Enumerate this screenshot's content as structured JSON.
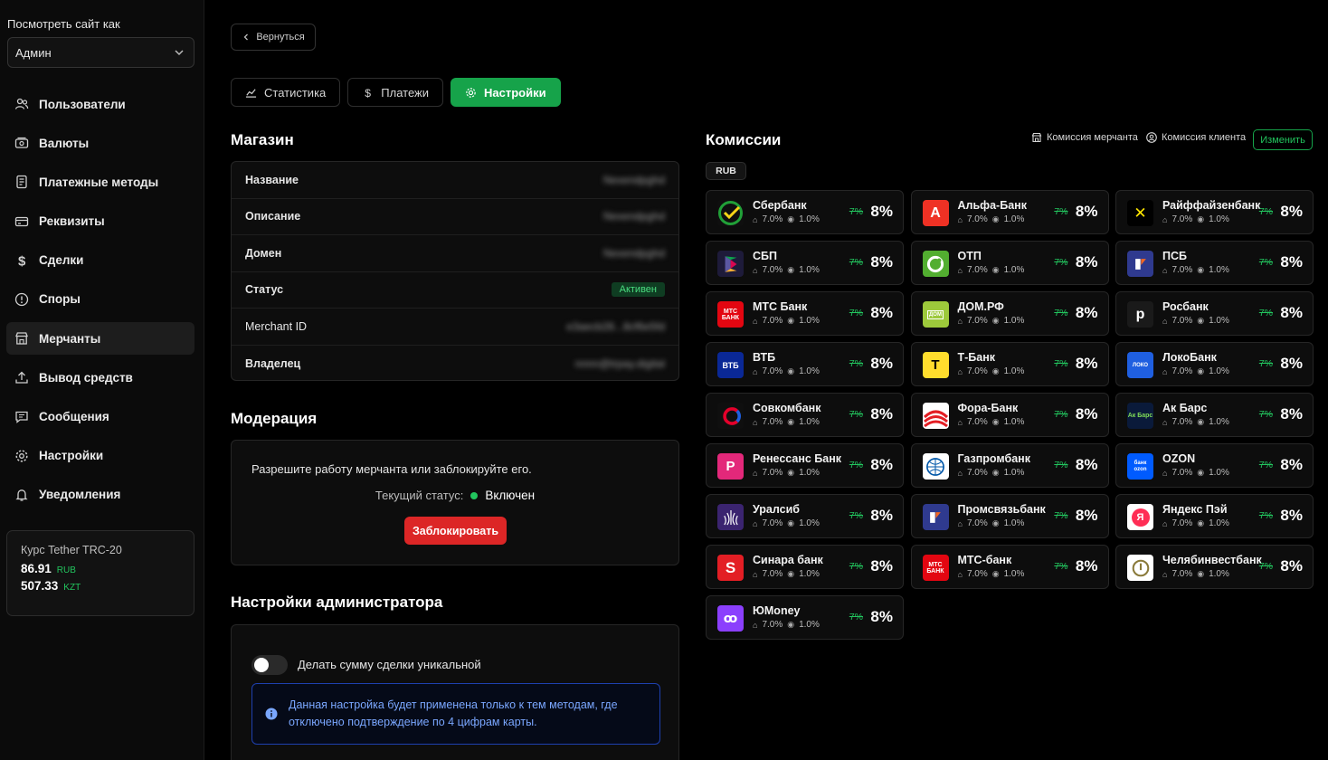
{
  "sidebar": {
    "view_as_label": "Посмотреть сайт как",
    "view_as_value": "Админ",
    "items": [
      {
        "label": "Пользователи",
        "icon": "users-icon"
      },
      {
        "label": "Валюты",
        "icon": "currency-icon"
      },
      {
        "label": "Платежные методы",
        "icon": "payment-methods-icon"
      },
      {
        "label": "Реквизиты",
        "icon": "card-icon"
      },
      {
        "label": "Сделки",
        "icon": "dollar-icon"
      },
      {
        "label": "Споры",
        "icon": "alert-icon"
      },
      {
        "label": "Мерчанты",
        "icon": "store-icon"
      },
      {
        "label": "Вывод средств",
        "icon": "upload-icon"
      },
      {
        "label": "Сообщения",
        "icon": "message-icon"
      },
      {
        "label": "Настройки",
        "icon": "gear-icon"
      },
      {
        "label": "Уведомления",
        "icon": "bell-icon"
      }
    ],
    "active_item": "Мерчанты",
    "rate": {
      "title": "Курс Tether TRC-20",
      "rows": [
        {
          "value": "86.91",
          "currency": "RUB"
        },
        {
          "value": "507.33",
          "currency": "KZT"
        }
      ]
    }
  },
  "main": {
    "back_label": "Вернуться",
    "tabs": [
      {
        "label": "Статистика",
        "icon": "chart-icon"
      },
      {
        "label": "Платежи",
        "icon": "dollar-icon"
      },
      {
        "label": "Настройки",
        "icon": "gear-icon"
      }
    ],
    "active_tab": "Настройки",
    "shop": {
      "title": "Магазин",
      "rows": [
        {
          "label": "Название",
          "value": "Nexendpghd"
        },
        {
          "label": "Описание",
          "value": "Nexendpghd"
        },
        {
          "label": "Домен",
          "value": "Nexendpghd"
        },
        {
          "label": "Статус",
          "value": "Активен"
        },
        {
          "label": "Merchant ID",
          "value": "e3aecb28...8cf6e5fd"
        },
        {
          "label": "Владелец",
          "value": "nnnn@trpay.digital"
        }
      ]
    },
    "moderation": {
      "title": "Модерация",
      "text": "Разрешите работу мерчанта или заблокируйте его.",
      "status_label": "Текущий статус:",
      "status_value": "Включен",
      "block_button": "Заблокировать"
    },
    "admin": {
      "title": "Настройки администратора",
      "toggle_label": "Делать сумму сделки уникальной",
      "toggle_on": false,
      "info_line1": "Данная настройка будет применена только к тем методам, где",
      "info_line2": "отключено подтверждение по 4 цифрам карты."
    }
  },
  "commissions": {
    "title": "Комиссии",
    "legend_merchant": "Комиссия мерчанта",
    "legend_client": "Комиссия клиента",
    "edit_button": "Изменить",
    "currency_badge": "RUB",
    "banks": [
      {
        "name": "Сбербанк",
        "merchant": "7.0%",
        "client": "1.0%",
        "old": "7%",
        "new": "8%",
        "color": "#0f0f0f",
        "logo": "sber-logo"
      },
      {
        "name": "Альфа-Банк",
        "merchant": "7.0%",
        "client": "1.0%",
        "old": "7%",
        "new": "8%",
        "color": "#ef3124",
        "logo": "alfa-logo"
      },
      {
        "name": "Райффайзенбанк",
        "merchant": "7.0%",
        "client": "1.0%",
        "old": "7%",
        "new": "8%",
        "color": "#000000",
        "logo": "raiffeisen-logo"
      },
      {
        "name": "СБП",
        "merchant": "7.0%",
        "client": "1.0%",
        "old": "7%",
        "new": "8%",
        "color": "#1e1b3a",
        "logo": "sbp-logo"
      },
      {
        "name": "ОТП",
        "merchant": "7.0%",
        "client": "1.0%",
        "old": "7%",
        "new": "8%",
        "color": "#52ae30",
        "logo": "otp-logo"
      },
      {
        "name": "ПСБ",
        "merchant": "7.0%",
        "client": "1.0%",
        "old": "7%",
        "new": "8%",
        "color": "#2f3a8f",
        "logo": "psb-logo"
      },
      {
        "name": "МТС Банк",
        "merchant": "7.0%",
        "client": "1.0%",
        "old": "7%",
        "new": "8%",
        "color": "#e30611",
        "logo": "mts-logo"
      },
      {
        "name": "ДОМ.РФ",
        "merchant": "7.0%",
        "client": "1.0%",
        "old": "7%",
        "new": "8%",
        "color": "#9dc93b",
        "logo": "domrf-logo"
      },
      {
        "name": "Росбанк",
        "merchant": "7.0%",
        "client": "1.0%",
        "old": "7%",
        "new": "8%",
        "color": "#1a1a1a",
        "logo": "rosbank-logo"
      },
      {
        "name": "ВТБ",
        "merchant": "7.0%",
        "client": "1.0%",
        "old": "7%",
        "new": "8%",
        "color": "#0a2896",
        "logo": "vtb-logo"
      },
      {
        "name": "Т-Банк",
        "merchant": "7.0%",
        "client": "1.0%",
        "old": "7%",
        "new": "8%",
        "color": "#ffdd2d",
        "logo": "tbank-logo"
      },
      {
        "name": "ЛокоБанк",
        "merchant": "7.0%",
        "client": "1.0%",
        "old": "7%",
        "new": "8%",
        "color": "#1f5fe0",
        "logo": "lokobank-logo"
      },
      {
        "name": "Совкомбанк",
        "merchant": "7.0%",
        "client": "1.0%",
        "old": "7%",
        "new": "8%",
        "color": "#0f0f0f",
        "logo": "sovcombank-logo"
      },
      {
        "name": "Фора-Банк",
        "merchant": "7.0%",
        "client": "1.0%",
        "old": "7%",
        "new": "8%",
        "color": "#ffffff",
        "logo": "fora-logo"
      },
      {
        "name": "Ак Барс",
        "merchant": "7.0%",
        "client": "1.0%",
        "old": "7%",
        "new": "8%",
        "color": "#0a1a3a",
        "logo": "akbars-logo"
      },
      {
        "name": "Ренессанс Банк",
        "merchant": "7.0%",
        "client": "1.0%",
        "old": "7%",
        "new": "8%",
        "color": "#e3287a",
        "logo": "renaissance-logo"
      },
      {
        "name": "Газпромбанк",
        "merchant": "7.0%",
        "client": "1.0%",
        "old": "7%",
        "new": "8%",
        "color": "#ffffff",
        "logo": "gazprombank-logo"
      },
      {
        "name": "OZON",
        "merchant": "7.0%",
        "client": "1.0%",
        "old": "7%",
        "new": "8%",
        "color": "#005bff",
        "logo": "ozon-logo"
      },
      {
        "name": "Уралсиб",
        "merchant": "7.0%",
        "client": "1.0%",
        "old": "7%",
        "new": "8%",
        "color": "#3b2470",
        "logo": "uralsib-logo"
      },
      {
        "name": "Промсвязьбанк",
        "merchant": "7.0%",
        "client": "1.0%",
        "old": "7%",
        "new": "8%",
        "color": "#2f3a8f",
        "logo": "promsvyaz-logo"
      },
      {
        "name": "Яндекс Пэй",
        "merchant": "7.0%",
        "client": "1.0%",
        "old": "7%",
        "new": "8%",
        "color": "#ffffff",
        "logo": "yandexpay-logo"
      },
      {
        "name": "Синара банк",
        "merchant": "7.0%",
        "client": "1.0%",
        "old": "7%",
        "new": "8%",
        "color": "#e31e24",
        "logo": "sinara-logo"
      },
      {
        "name": "МТС-банк",
        "merchant": "7.0%",
        "client": "1.0%",
        "old": "7%",
        "new": "8%",
        "color": "#e30611",
        "logo": "mts-logo"
      },
      {
        "name": "Челябинвестбанк",
        "merchant": "7.0%",
        "client": "1.0%",
        "old": "7%",
        "new": "8%",
        "color": "#ffffff",
        "logo": "chelinvest-logo"
      },
      {
        "name": "ЮMoney",
        "merchant": "7.0%",
        "client": "1.0%",
        "old": "7%",
        "new": "8%",
        "color": "#8b3ffd",
        "logo": "yumoney-logo"
      }
    ]
  }
}
